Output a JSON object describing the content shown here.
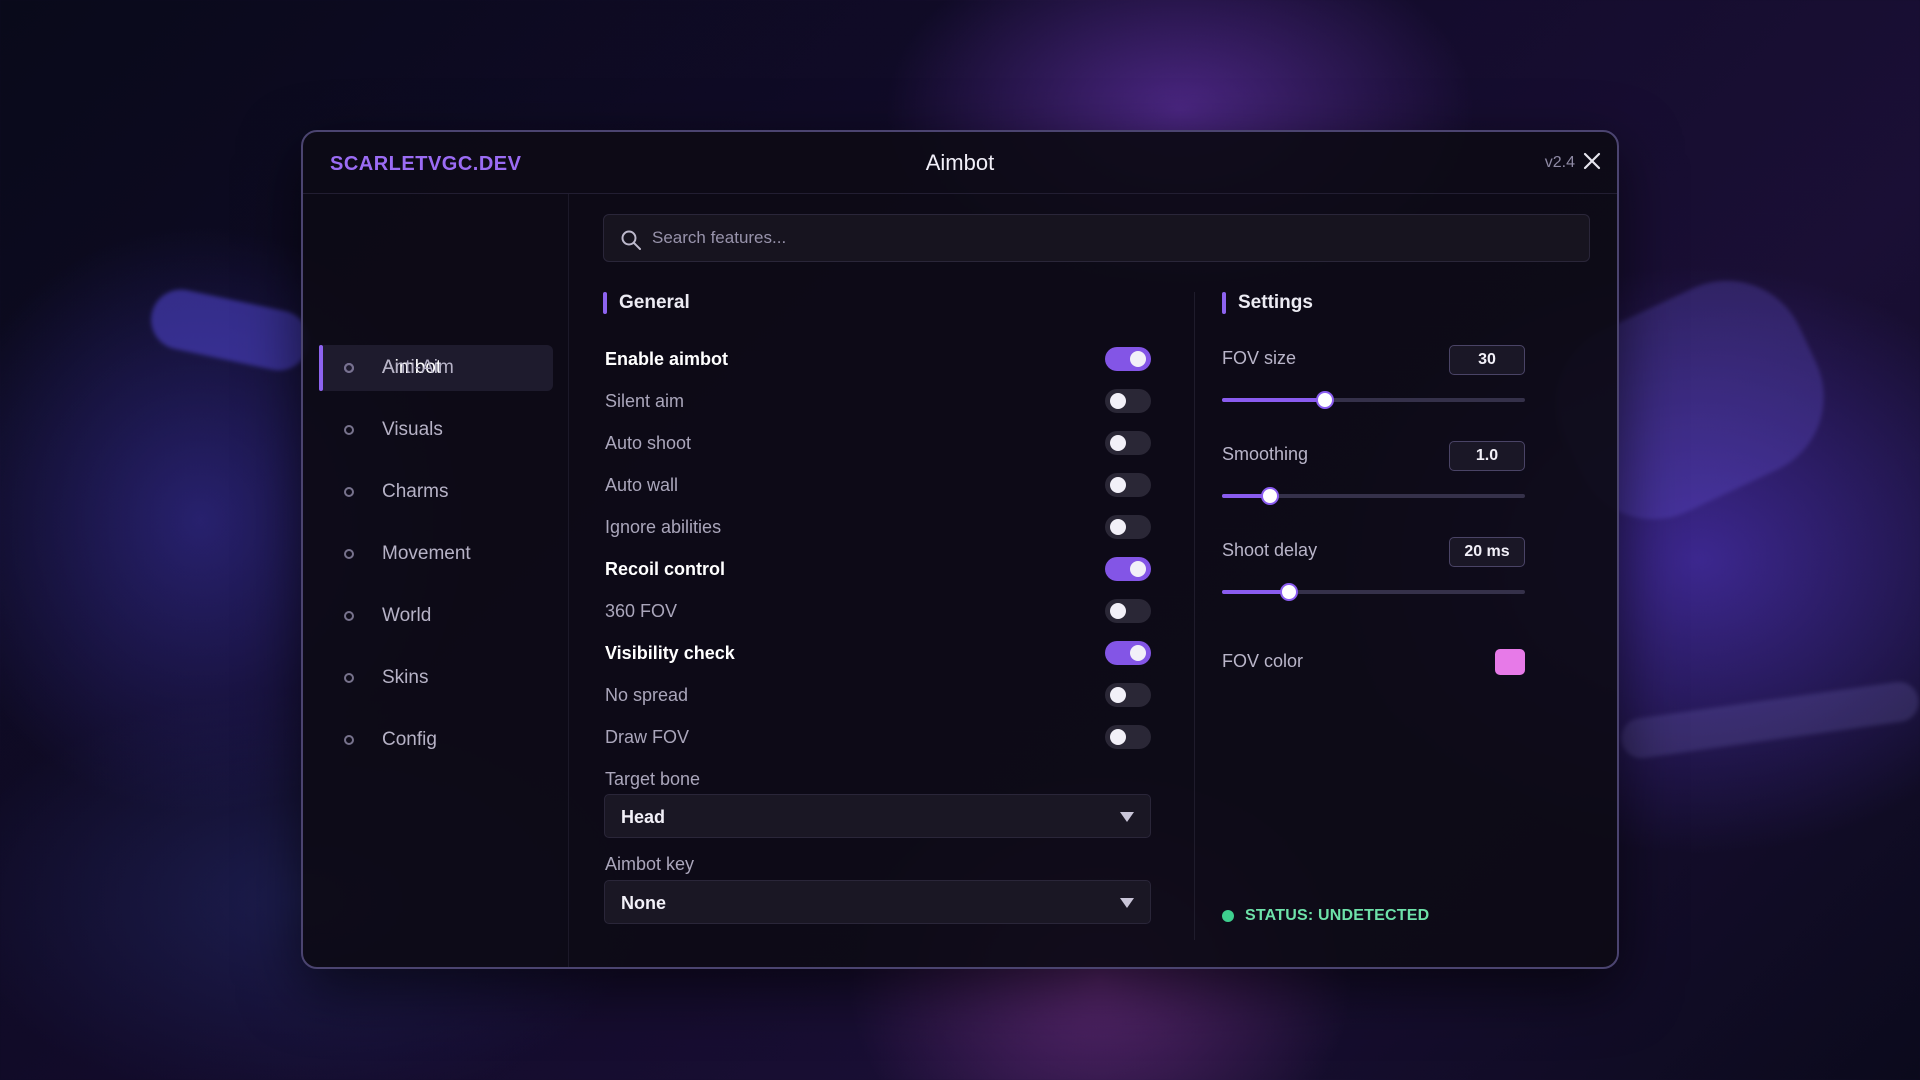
{
  "window": {
    "brand": "SCARLETVGC.DEV",
    "title": "Aimbot",
    "version": "v2.4"
  },
  "sidebar": {
    "items": [
      {
        "label": "Aimbot",
        "active": true
      },
      {
        "label": "Anti-Aim",
        "active": false
      },
      {
        "label": "Visuals",
        "active": false
      },
      {
        "label": "Charms",
        "active": false
      },
      {
        "label": "Movement",
        "active": false
      },
      {
        "label": "World",
        "active": false
      },
      {
        "label": "Skins",
        "active": false
      },
      {
        "label": "Config",
        "active": false
      }
    ]
  },
  "search": {
    "placeholder": "Search features...",
    "value": ""
  },
  "general": {
    "title": "General",
    "toggles": [
      {
        "label": "Enable aimbot",
        "on": true
      },
      {
        "label": "Silent aim",
        "on": false
      },
      {
        "label": "Auto shoot",
        "on": false
      },
      {
        "label": "Auto wall",
        "on": false
      },
      {
        "label": "Ignore abilities",
        "on": false
      },
      {
        "label": "Recoil control",
        "on": true
      },
      {
        "label": "360 FOV",
        "on": false
      },
      {
        "label": "Visibility check",
        "on": true
      },
      {
        "label": "No spread",
        "on": false
      },
      {
        "label": "Draw FOV",
        "on": false
      }
    ],
    "target_bone": {
      "label": "Target bone",
      "value": "Head"
    },
    "aimbot_key": {
      "label": "Aimbot key",
      "value": "None"
    }
  },
  "settings": {
    "title": "Settings",
    "sliders": [
      {
        "label": "FOV size",
        "value": "30",
        "fraction": 0.34
      },
      {
        "label": "Smoothing",
        "value": "1.0",
        "fraction": 0.16
      },
      {
        "label": "Shoot delay",
        "value": "20 ms",
        "fraction": 0.22
      }
    ],
    "fov_color": {
      "label": "FOV color",
      "color": "#e77ae8"
    }
  },
  "status": {
    "text": "STATUS: UNDETECTED",
    "color": "#3ecf8e"
  },
  "colors": {
    "accent": "#8d63ef",
    "brand": "#9b6cf4"
  }
}
